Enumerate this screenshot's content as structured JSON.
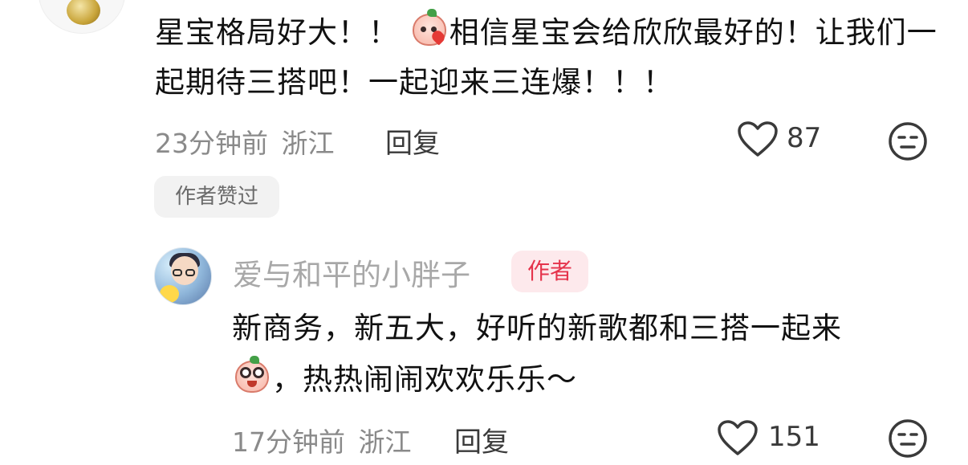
{
  "comment1": {
    "text_before_emoji": "星宝格局好大！！",
    "emoji_name": "kiss-heart-emoji",
    "text_after_emoji": "相信星宝会给欣欣最好的！让我们一起期待三搭吧！一起迎来三连爆！！！",
    "time": "23分钟前",
    "location": "浙江",
    "reply_label": "回复",
    "like_count": "87",
    "author_liked_label": "作者赞过"
  },
  "comment2": {
    "username": "爱与和平的小胖子",
    "author_badge": "作者",
    "text_line1": "新商务，新五大，好听的新歌都和三搭一起来",
    "emoji_name": "wide-eyed-emoji",
    "text_after_emoji": "，热热闹闹欢欢乐乐～",
    "time": "17分钟前",
    "location": "浙江",
    "reply_label": "回复",
    "like_count": "151"
  },
  "colors": {
    "text": "#111111",
    "meta": "#8a8a8a",
    "username": "#a8a8a8",
    "author_badge_bg": "#fde9ec",
    "author_badge_text": "#e5334b",
    "chip_bg": "#f2f2f2"
  }
}
